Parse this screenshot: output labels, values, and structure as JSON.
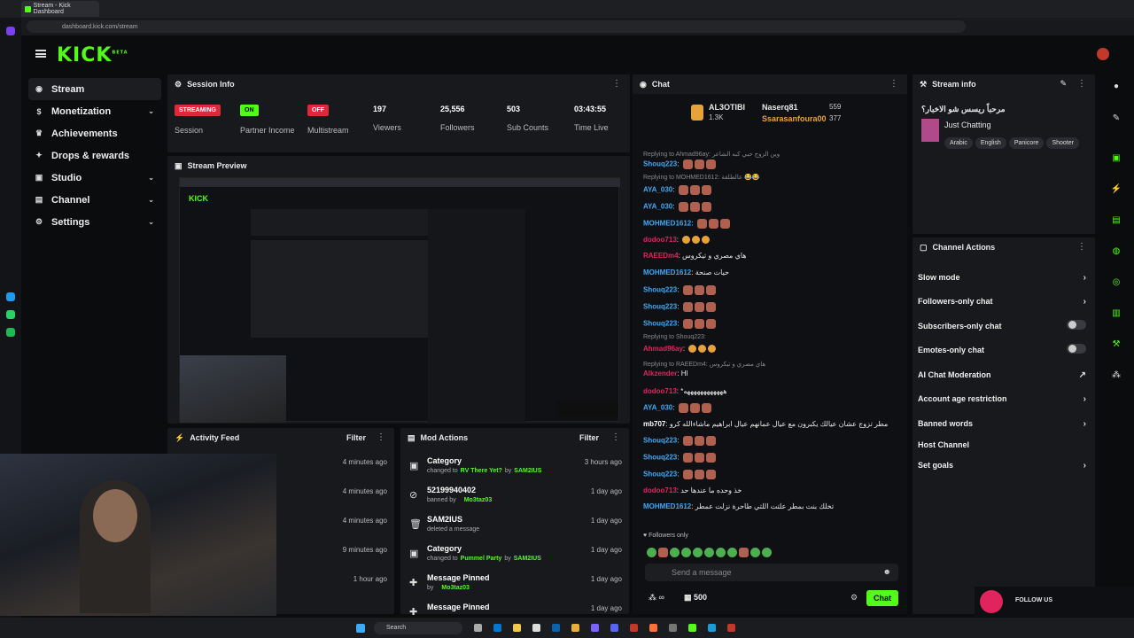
{
  "browser": {
    "tab_title": "Stream - Kick Dashboard",
    "url": "dashboard.kick.com/stream"
  },
  "brand": {
    "logo": "KICK",
    "logo_sup": "BETA",
    "accent": "#53fc18"
  },
  "nav": [
    {
      "label": "Stream",
      "icon": "broadcast-icon"
    },
    {
      "label": "Monetization",
      "icon": "dollar-icon"
    },
    {
      "label": "Achievements",
      "icon": "trophy-icon"
    },
    {
      "label": "Drops & rewards",
      "icon": "gift-icon"
    },
    {
      "label": "Studio",
      "icon": "studio-icon"
    },
    {
      "label": "Channel",
      "icon": "channel-icon"
    },
    {
      "label": "Settings",
      "icon": "gear-icon"
    }
  ],
  "session": {
    "title": "Session Info",
    "items": [
      {
        "value": "STREAMING",
        "label": "Session"
      },
      {
        "value": "ON",
        "label": "Partner Income"
      },
      {
        "value": "OFF",
        "label": "Multistream"
      },
      {
        "value": "197",
        "label": "Viewers"
      },
      {
        "value": "25,556",
        "label": "Followers"
      },
      {
        "value": "503",
        "label": "Sub Counts"
      },
      {
        "value": "03:43:55",
        "label": "Time Live"
      }
    ]
  },
  "preview": {
    "title": "Stream Preview"
  },
  "activity": {
    "title": "Activity Feed",
    "filter": "Filter",
    "times": [
      "4 minutes ago",
      "4 minutes ago",
      "4 minutes ago",
      "9 minutes ago",
      "1 hour ago"
    ]
  },
  "mod": {
    "title": "Mod Actions",
    "filter": "Filter",
    "items": [
      {
        "title": "Category",
        "sub": "changed to",
        "target": "RV There Yet?",
        "by": "by",
        "who": "SAM2IUS",
        "time": "3 hours ago"
      },
      {
        "title": "52199940402",
        "sub": "banned by",
        "target": "",
        "by": "",
        "who": "Mo3taz03",
        "time": "1 day ago"
      },
      {
        "title": "SAM2IUS",
        "sub": "deleted a message",
        "target": "",
        "by": "",
        "who": "",
        "time": "1 day ago"
      },
      {
        "title": "Category",
        "sub": "changed to",
        "target": "Pummel Party",
        "by": "by",
        "who": "SAM2IUS",
        "time": "1 day ago"
      },
      {
        "title": "Message Pinned",
        "sub": "by",
        "target": "",
        "by": "",
        "who": "Mo3taz03",
        "time": "1 day ago"
      },
      {
        "title": "Message Pinned",
        "sub": "",
        "target": "",
        "by": "",
        "who": "",
        "time": "1 day ago"
      }
    ]
  },
  "chat": {
    "title": "Chat",
    "top1": {
      "name": "AL3OTIBI",
      "sub": "1.3K"
    },
    "top2": {
      "name": "Naserq81",
      "val": "559"
    },
    "top3": {
      "name": "Ssarasanfoura00",
      "val": "377"
    },
    "lines": [
      {
        "type": "reply",
        "text": "Replying to Ahmad96ay: وين الزوج حبي كبه الشاعر"
      },
      {
        "user": "Shouq223",
        "color": "#3fa9f5",
        "text": ""
      },
      {
        "type": "reply",
        "text": "Replying to MOHMED1612: عالطلقة 😂😂"
      },
      {
        "user": "AYA_030",
        "color": "#3fa9f5",
        "text": ""
      },
      {
        "user": "AYA_030",
        "color": "#3fa9f5",
        "text": ""
      },
      {
        "user": "MOHMED1612",
        "color": "#3fa9f5",
        "text": ""
      },
      {
        "user": "dodoo713",
        "color": "#e0245e",
        "text": ""
      },
      {
        "user": "RAEEDm4",
        "color": "#e0245e",
        "text": "هاي مصري و تيكروس"
      },
      {
        "user": "MOHMED1612",
        "color": "#3fa9f5",
        "text": "حيات صنحة"
      },
      {
        "user": "Shouq223",
        "color": "#3fa9f5",
        "text": ""
      },
      {
        "user": "Shouq223",
        "color": "#3fa9f5",
        "text": ""
      },
      {
        "user": "Shouq223",
        "color": "#3fa9f5",
        "text": ""
      },
      {
        "type": "reply",
        "text": "Replying to Shouq223:"
      },
      {
        "user": "Ahmad96ay",
        "color": "#e0245e",
        "text": ""
      },
      {
        "type": "reply",
        "text": "Replying to RAEEDm4: هاي مصري و تيكروس"
      },
      {
        "user": "Alkzender",
        "color": "#e0245e",
        "text": "HI"
      },
      {
        "user": "dodoo713",
        "color": "#e0245e",
        "text": "*ههههههههههههه"
      },
      {
        "user": "AYA_030",
        "color": "#3fa9f5",
        "text": ""
      },
      {
        "user": "mb707",
        "color": "#ffffff",
        "text": "مطر تزوج عشان عيالك يكبرون مع عيال عمانهم عيال ابراهيم ماشاءالله كرو"
      },
      {
        "user": "Shouq223",
        "color": "#3fa9f5",
        "text": ""
      },
      {
        "user": "Shouq223",
        "color": "#3fa9f5",
        "text": ""
      },
      {
        "user": "Shouq223",
        "color": "#3fa9f5",
        "text": ""
      },
      {
        "user": "dodoo713",
        "color": "#e0245e",
        "text": "خذ وحده ما عندها حد"
      },
      {
        "user": "MOHMED1612",
        "color": "#3fa9f5",
        "text": "تخلك بنت بمطر علتت اللتي طاحرة نزلت عمطر"
      }
    ],
    "followers_only": "Followers only",
    "send_placeholder": "Send a message",
    "count": "500",
    "chat_btn": "Chat"
  },
  "stream_info": {
    "title": "Stream info",
    "stream_title": "مرحباً ريسس شو الاخبار؟",
    "category": "Just Chatting",
    "tags": [
      "Arabic",
      "English",
      "Panicore",
      "Shooter"
    ]
  },
  "channel_actions": {
    "title": "Channel Actions",
    "items": [
      {
        "label": "Slow mode",
        "ctrl": "chev"
      },
      {
        "label": "Followers-only chat",
        "ctrl": "chev"
      },
      {
        "label": "Subscribers-only chat",
        "ctrl": "toggle"
      },
      {
        "label": "Emotes-only chat",
        "ctrl": "toggle"
      },
      {
        "label": "AI Chat Moderation",
        "ctrl": "ext"
      },
      {
        "label": "Account age restriction",
        "ctrl": "chev"
      },
      {
        "label": "Banned words",
        "ctrl": "chev"
      },
      {
        "label": "Host Channel",
        "ctrl": "none"
      },
      {
        "label": "Set goals",
        "ctrl": "chev"
      }
    ]
  },
  "overlay": {
    "follow": "FOLLOW US",
    "search": "Search"
  }
}
